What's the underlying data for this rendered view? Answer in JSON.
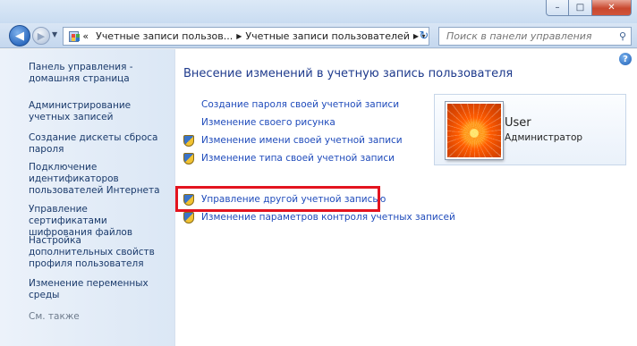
{
  "window": {
    "controls": {
      "minimize": "–",
      "maximize": "□",
      "close": "✕"
    }
  },
  "navbar": {
    "back_glyph": "◀",
    "forward_glyph": "▶",
    "history_glyph": "▼",
    "breadcrumbs": [
      "«",
      "Учетные записи пользов...",
      "Учетные записи пользователей"
    ],
    "breadcrumb_separator": "▶",
    "address_dropdown_glyph": "▾",
    "refresh_glyph": "↻",
    "search_placeholder": "Поиск в панели управления",
    "search_glyph": "⚲"
  },
  "sidebar": {
    "items": [
      "Панель управления - домашняя страница",
      "Администрирование учетных записей",
      "Создание дискеты сброса пароля",
      "Подключение идентификаторов пользователей Интернета",
      "Управление сертификатами шифрования файлов",
      "Настройка дополнительных свойств профиля пользователя",
      "Изменение переменных среды"
    ],
    "see_also": "См. также"
  },
  "help_glyph": "?",
  "main": {
    "title": "Внесение изменений в учетную запись пользователя",
    "tasks": [
      {
        "label": "Создание пароля своей учетной записи",
        "icon": "none"
      },
      {
        "label": "Изменение своего рисунка",
        "icon": "none"
      },
      {
        "label": "Изменение имени своей учетной записи",
        "icon": "uac-shield-icon"
      },
      {
        "label": "Изменение типа своей учетной записи",
        "icon": "uac-shield-icon"
      },
      {
        "label": "Управление другой учетной записью",
        "icon": "uac-shield-icon"
      },
      {
        "label": "Изменение параметров контроля учетных записей",
        "icon": "uac-shield-icon"
      }
    ],
    "highlight_color": "#e3141f"
  },
  "user": {
    "name": "User",
    "role": "Администратор",
    "avatar": "orange-flower-avatar"
  },
  "colors": {
    "link": "#1f4bbb",
    "title": "#1e3a8c",
    "sidebar_link": "#1a3a6b"
  }
}
